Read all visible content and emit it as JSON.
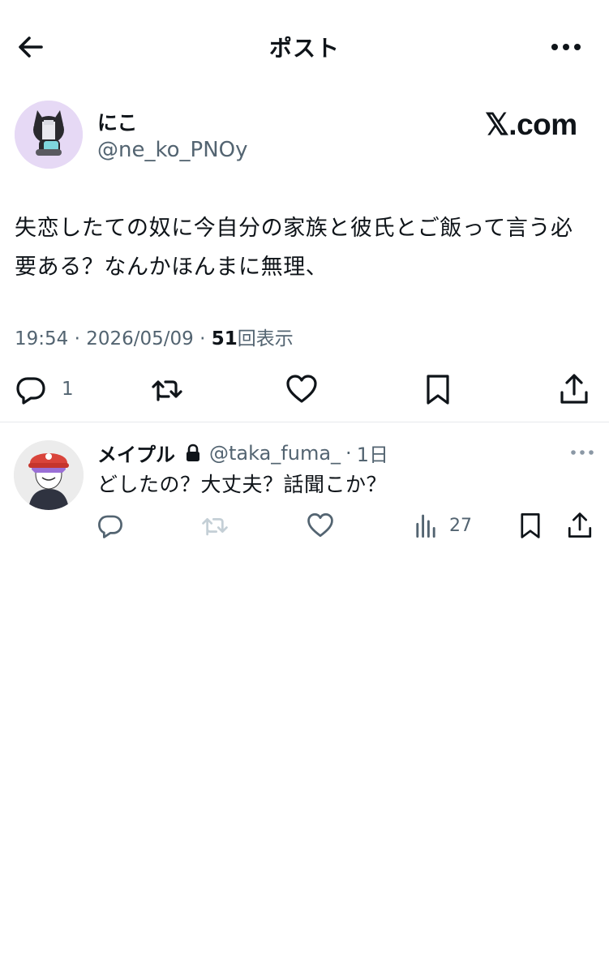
{
  "header": {
    "title": "ポスト",
    "back_icon": "arrow-left-icon",
    "more_icon": "more-horizontal-icon"
  },
  "post": {
    "author_name": "にこ",
    "author_handle": "@ne_ko_PNOy",
    "watermark": "𝕏.com",
    "text": "失恋したての奴に今自分の家族と彼氏とご飯って言う必要ある？なんかほんまに無理、",
    "time": "19:54",
    "date": "2026/05/09",
    "views": "51",
    "views_label": "回表示",
    "actions": {
      "reply_icon": "reply-icon",
      "reply_count": "1",
      "repost_icon": "repost-icon",
      "like_icon": "heart-icon",
      "bookmark_icon": "bookmark-icon",
      "share_icon": "share-icon"
    }
  },
  "reply": {
    "name": "メイプル",
    "lock_icon": "lock-icon",
    "handle": "@taka_fuma_",
    "separator": "·",
    "time": "1日",
    "text": "どしたの？大丈夫？話聞こか？",
    "actions": {
      "reply_icon": "reply-icon",
      "repost_icon": "repost-icon",
      "like_icon": "heart-icon",
      "views_icon": "bar-chart-icon",
      "views_count": "27",
      "bookmark_icon": "bookmark-icon",
      "share_icon": "share-icon"
    }
  },
  "colors": {
    "text": "#0f1419",
    "secondary": "#536471",
    "divider": "#e6e9ec",
    "disabled_repost": "#c4cfd6"
  }
}
